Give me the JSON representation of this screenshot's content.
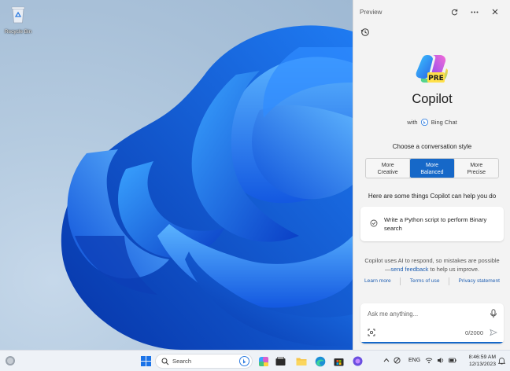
{
  "desktop": {
    "recycle_bin_label": "Recycle Bin"
  },
  "panel": {
    "header_title": "Preview",
    "brand_title": "Copilot",
    "logo_badge": "PRE",
    "with_prefix": "with",
    "with_product": "Bing Chat",
    "conversation_style_heading": "Choose a conversation style",
    "styles": [
      {
        "line1": "More",
        "line2": "Creative"
      },
      {
        "line1": "More",
        "line2": "Balanced"
      },
      {
        "line1": "More",
        "line2": "Precise"
      }
    ],
    "help_heading": "Here are some things Copilot can help you do",
    "suggestion": "Write a Python script to perform Binary search",
    "disclaimer_part1": "Copilot uses AI to respond, so mistakes are possible—",
    "disclaimer_link": "send feedback",
    "disclaimer_part2": " to help us improve.",
    "links": {
      "learn_more": "Learn more",
      "terms": "Terms of use",
      "privacy": "Privacy statement"
    },
    "input_placeholder": "Ask me anything...",
    "char_count": "0/2000"
  },
  "taskbar": {
    "search_placeholder": "Search",
    "language": "ENG",
    "time": "8:46:59 AM",
    "date": "12/13/2023"
  },
  "colors": {
    "accent": "#1668c8",
    "link": "#1f5fb2",
    "panel_bg": "#f3f3f3"
  }
}
